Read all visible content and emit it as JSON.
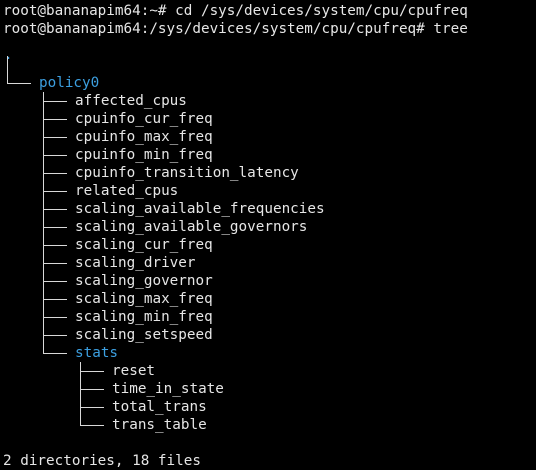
{
  "terminal": {
    "commands": [
      "root@bananapim64:~# cd /sys/devices/system/cpu/cpufreq",
      "root@bananapim64:/sys/devices/system/cpu/cpufreq# tree"
    ],
    "root_dot": ".",
    "tree": {
      "root_dir": "policy0",
      "files": [
        "affected_cpus",
        "cpuinfo_cur_freq",
        "cpuinfo_max_freq",
        "cpuinfo_min_freq",
        "cpuinfo_transition_latency",
        "related_cpus",
        "scaling_available_frequencies",
        "scaling_available_governors",
        "scaling_cur_freq",
        "scaling_driver",
        "scaling_governor",
        "scaling_max_freq",
        "scaling_min_freq",
        "scaling_setspeed"
      ],
      "sub_dir": "stats",
      "sub_files": [
        "reset",
        "time_in_state",
        "total_trans",
        "trans_table"
      ]
    },
    "summary": "2 directories, 18 files",
    "colors": {
      "background": "#000000",
      "text": "#e6e6e6",
      "directory": "#3c9fe0"
    }
  }
}
